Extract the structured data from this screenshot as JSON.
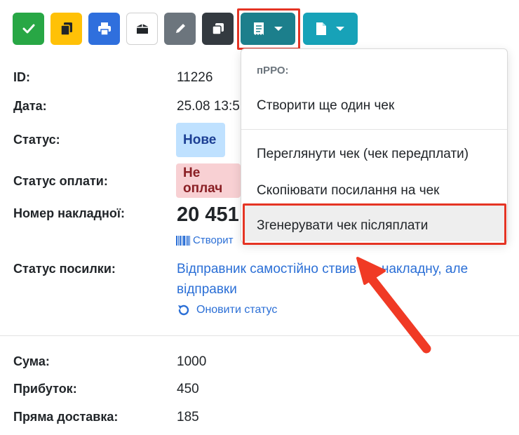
{
  "toolbar": {
    "buttons": [
      {
        "name": "check-icon",
        "color": "#28a745"
      },
      {
        "name": "copy-icon",
        "color": "#ffc107"
      },
      {
        "name": "print-icon",
        "color": "#2f6fdd"
      },
      {
        "name": "box-icon",
        "color": "#ffffff"
      },
      {
        "name": "pencil-icon",
        "color": "#6c757d"
      },
      {
        "name": "duplicate-icon",
        "color": "#343a40"
      },
      {
        "name": "receipt-icon",
        "color": "#1c7f8c"
      },
      {
        "name": "document-icon",
        "color": "#17a2b8"
      }
    ]
  },
  "details": {
    "id_label": "ID:",
    "id_value": "11226",
    "date_label": "Дата:",
    "date_value": "25.08 13:5",
    "status_label": "Статус:",
    "status_value": "Нове",
    "payment_label": "Статус оплати:",
    "payment_value": "Не оплач",
    "invoice_label": "Номер накладної:",
    "invoice_value": "20 451",
    "create_link": "Створит",
    "parcel_label": "Статус посилки:",
    "parcel_text_1": "Відправник самостійно ств",
    "parcel_text_1b": "ив цю накладну, але",
    "parcel_text_2": "відправки",
    "refresh_link": "Оновити статус",
    "sum_label": "Сума:",
    "sum_value": "1000",
    "profit_label": "Прибуток:",
    "profit_value": "450",
    "direct_label": "Пряма доставка:",
    "direct_value": "185"
  },
  "dropdown": {
    "header": "пРРО:",
    "items": [
      "Створити ще один чек",
      "Переглянути чек (чек передплати)",
      "Скопіювати посилання на чек",
      "Згенерувати чек післяплати"
    ]
  },
  "colors": {
    "highlight": "#e53424",
    "link": "#2b6fd6",
    "status_badge_bg": "#bfe1ff",
    "status_badge_text": "#1c3f94",
    "payment_badge_bg": "#f8d0d3",
    "payment_badge_text": "#8a1f24"
  }
}
